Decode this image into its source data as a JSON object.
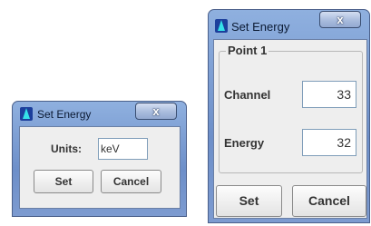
{
  "small_dialog": {
    "title": "Set Energy",
    "close_label": "x",
    "units_label": "Units:",
    "units_value": "keV",
    "set_label": "Set",
    "cancel_label": "Cancel"
  },
  "large_dialog": {
    "title": "Set Energy",
    "close_label": "x",
    "group_title": "Point 1",
    "channel_label": "Channel",
    "channel_value": "33",
    "energy_label": "Energy",
    "energy_value": "32",
    "set_label": "Set",
    "cancel_label": "Cancel"
  }
}
